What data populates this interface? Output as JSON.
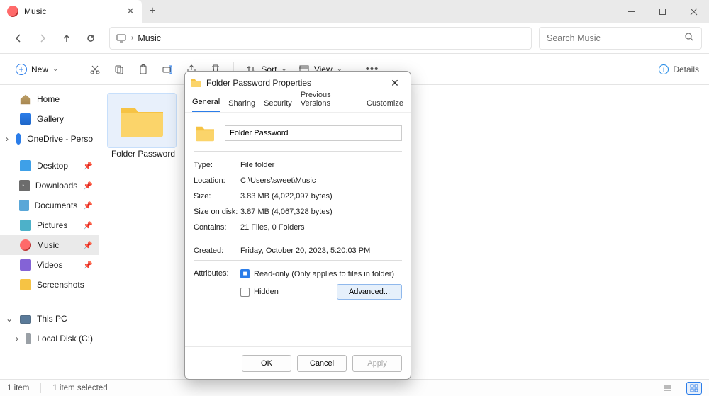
{
  "titlebar": {
    "tab_title": "Music"
  },
  "address": {
    "crumb": "Music"
  },
  "search": {
    "placeholder": "Search Music"
  },
  "toolbar": {
    "new_label": "New",
    "sort_label": "Sort",
    "view_label": "View",
    "details_label": "Details"
  },
  "sidebar": {
    "home": "Home",
    "gallery": "Gallery",
    "onedrive": "OneDrive - Perso",
    "desktop": "Desktop",
    "downloads": "Downloads",
    "documents": "Documents",
    "pictures": "Pictures",
    "music": "Music",
    "videos": "Videos",
    "screenshots": "Screenshots",
    "thispc": "This PC",
    "localdisk": "Local Disk (C:)"
  },
  "content": {
    "folder_name": "Folder Password"
  },
  "status": {
    "count": "1 item",
    "selected": "1 item selected"
  },
  "dialog": {
    "title": "Folder Password Properties",
    "tabs": {
      "general": "General",
      "sharing": "Sharing",
      "security": "Security",
      "prev": "Previous Versions",
      "customize": "Customize"
    },
    "name_value": "Folder Password",
    "rows": {
      "type_k": "Type:",
      "type_v": "File folder",
      "loc_k": "Location:",
      "loc_v": "C:\\Users\\sweet\\Music",
      "size_k": "Size:",
      "size_v": "3.83 MB (4,022,097 bytes)",
      "sod_k": "Size on disk:",
      "sod_v": "3.87 MB (4,067,328 bytes)",
      "cont_k": "Contains:",
      "cont_v": "21 Files, 0 Folders",
      "created_k": "Created:",
      "created_v": "Friday, October 20, 2023, 5:20:03 PM",
      "attr_k": "Attributes:",
      "readonly": "Read-only (Only applies to files in folder)",
      "hidden": "Hidden",
      "advanced": "Advanced..."
    },
    "buttons": {
      "ok": "OK",
      "cancel": "Cancel",
      "apply": "Apply"
    }
  }
}
